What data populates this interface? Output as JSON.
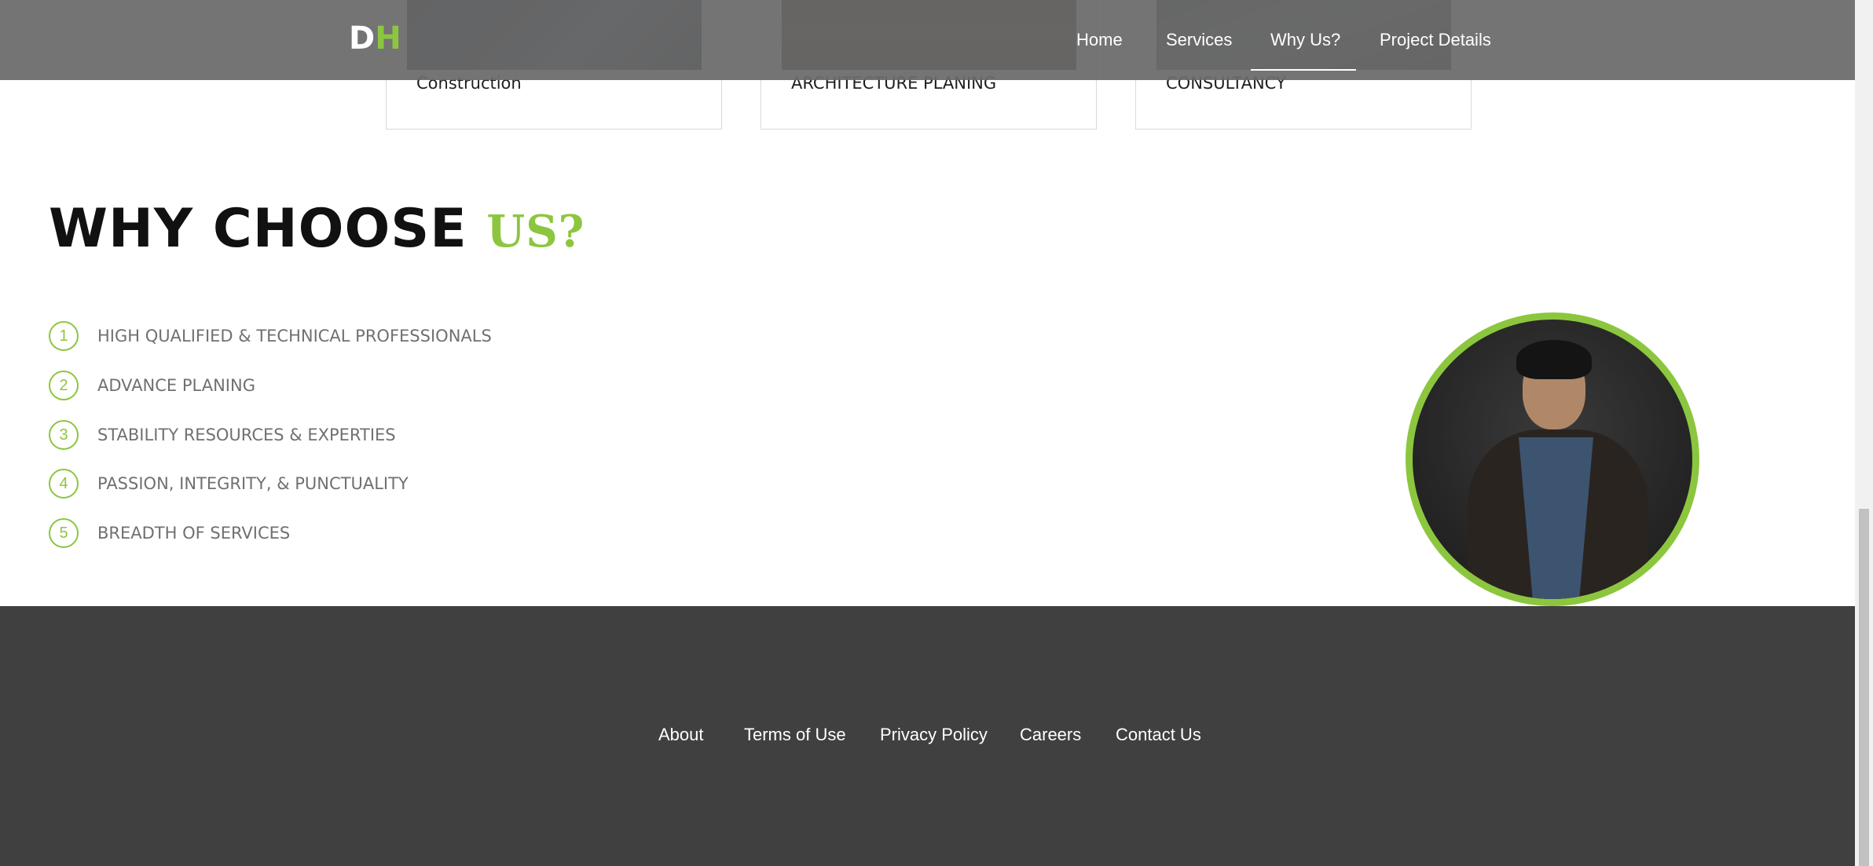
{
  "header": {
    "logo_d": "D",
    "logo_h": "H",
    "nav": {
      "home": "Home",
      "services": "Services",
      "why_us": "Why Us?",
      "project_details": "Project Details"
    }
  },
  "services": {
    "cards": [
      {
        "label": "Construction"
      },
      {
        "label": "ARCHITECTURE PLANING"
      },
      {
        "label": "CONSULTANCY"
      }
    ]
  },
  "why": {
    "title_main": "WHY CHOOSE",
    "title_accent": "US?",
    "reasons": [
      {
        "num": "1",
        "text": "HIGH QUALIFIED & TECHNICAL PROFESSIONALS"
      },
      {
        "num": "2",
        "text": "ADVANCE PLANING"
      },
      {
        "num": "3",
        "text": "STABILITY RESOURCES & EXPERTIES"
      },
      {
        "num": "4",
        "text": "PASSION, INTEGRITY, & PUNCTUALITY"
      },
      {
        "num": "5",
        "text": "BREADTH OF SERVICES"
      }
    ]
  },
  "footer": {
    "links": {
      "about": "About",
      "terms": "Terms of Use",
      "privacy": "Privacy Policy",
      "careers": "Careers",
      "contact": "Contact Us"
    }
  },
  "colors": {
    "accent": "#8cc63f",
    "header_bg": "#696969",
    "footer_bg": "#404040"
  }
}
